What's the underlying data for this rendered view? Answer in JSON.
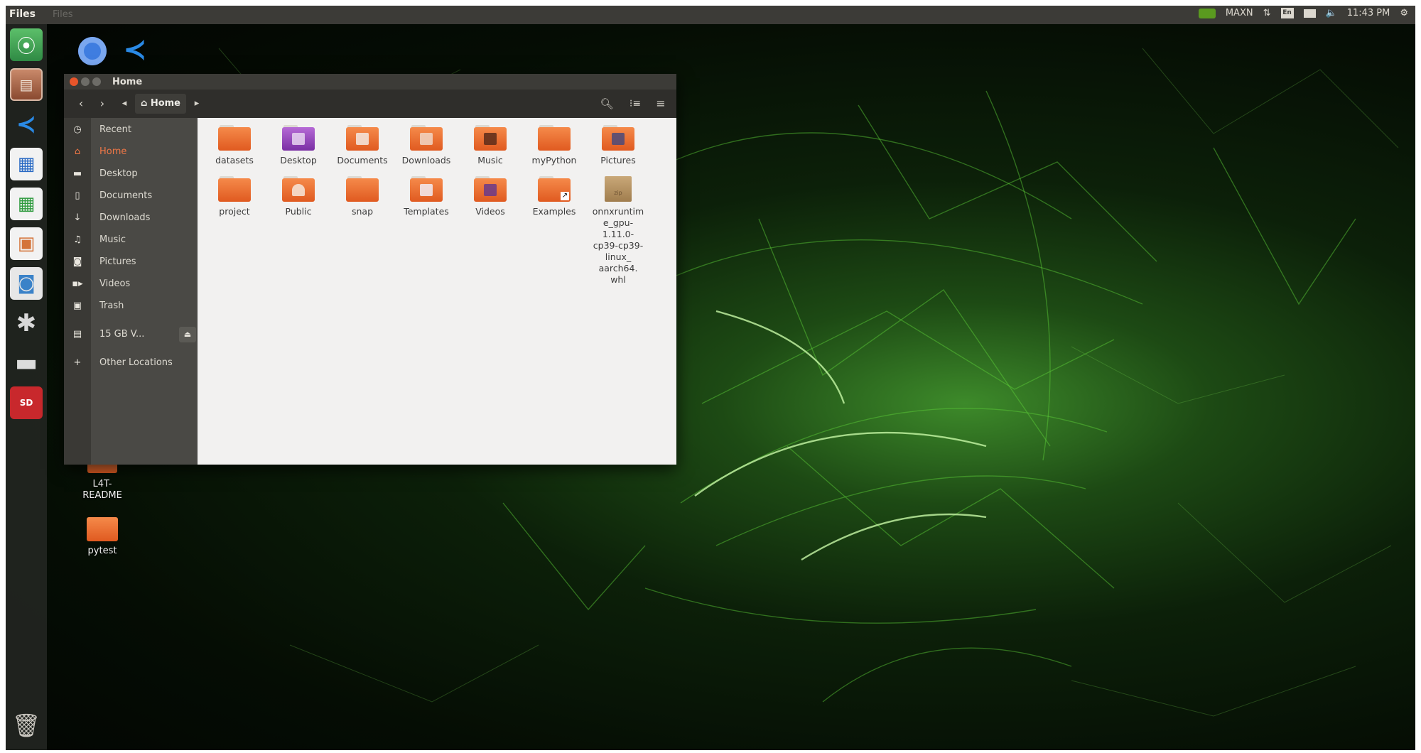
{
  "top_panel": {
    "app_title": "Files",
    "menu_hint": "Files",
    "power_mode": "MAXN",
    "keyboard_layout": "En",
    "clock": "11:43 PM",
    "icons": [
      "nvidia-icon",
      "network-icon",
      "keyboard-icon",
      "mail-icon",
      "volume-icon",
      "gear-icon"
    ]
  },
  "launcher": {
    "items": [
      {
        "name": "ubuntu-dash-icon",
        "color": "#3f9a50"
      },
      {
        "name": "files-icon",
        "color": "#b06a4a"
      },
      {
        "name": "vscode-icon",
        "color": "#1f7ad6"
      },
      {
        "name": "writer-icon",
        "color": "#2a6ac4"
      },
      {
        "name": "calc-icon",
        "color": "#2e9a3e"
      },
      {
        "name": "impress-icon",
        "color": "#d4743a"
      },
      {
        "name": "software-center-icon",
        "color": "#3a82c8"
      },
      {
        "name": "system-settings-icon",
        "color": "#c8352a"
      },
      {
        "name": "drive-icon",
        "color": "#cfcfcf"
      },
      {
        "name": "sd-card-icon",
        "color": "#c8282c"
      },
      {
        "name": "trash-icon",
        "color": "#b7b4ad"
      }
    ]
  },
  "desktop": {
    "icons": [
      {
        "label": "L4T-README"
      },
      {
        "label": "pytest"
      }
    ],
    "top_icons": [
      "chromium-icon",
      "vscode-icon"
    ]
  },
  "window": {
    "title": "Home",
    "breadcrumb": "Home",
    "sidebar": [
      {
        "label": "Recent",
        "icon": "clock-icon"
      },
      {
        "label": "Home",
        "icon": "home-icon",
        "active": true
      },
      {
        "label": "Desktop",
        "icon": "desktop-icon"
      },
      {
        "label": "Documents",
        "icon": "document-icon"
      },
      {
        "label": "Downloads",
        "icon": "download-icon"
      },
      {
        "label": "Music",
        "icon": "music-icon"
      },
      {
        "label": "Pictures",
        "icon": "camera-icon"
      },
      {
        "label": "Videos",
        "icon": "video-icon"
      },
      {
        "label": "Trash",
        "icon": "trash-icon"
      },
      {
        "label": "15 GB V...",
        "icon": "drive-icon"
      },
      {
        "label": "Other Locations",
        "icon": "plus-icon"
      }
    ],
    "files": [
      {
        "label": "datasets"
      },
      {
        "label": "Desktop"
      },
      {
        "label": "Documents"
      },
      {
        "label": "Downloads"
      },
      {
        "label": "Music"
      },
      {
        "label": "myPython"
      },
      {
        "label": "Pictures"
      },
      {
        "label": "project"
      },
      {
        "label": "Public"
      },
      {
        "label": "snap"
      },
      {
        "label": "Templates"
      },
      {
        "label": "Videos"
      },
      {
        "label": "Examples"
      },
      {
        "label": "onnxruntime_gpu-1.11.0-cp39-cp39-linux_aarch64.whl",
        "display_lines": [
          "onnxruntim",
          "e_gpu-",
          "1.11.0-",
          "cp39-cp39-",
          "linux_",
          "aarch64.",
          "whl"
        ]
      }
    ],
    "zip_label": "zip"
  }
}
